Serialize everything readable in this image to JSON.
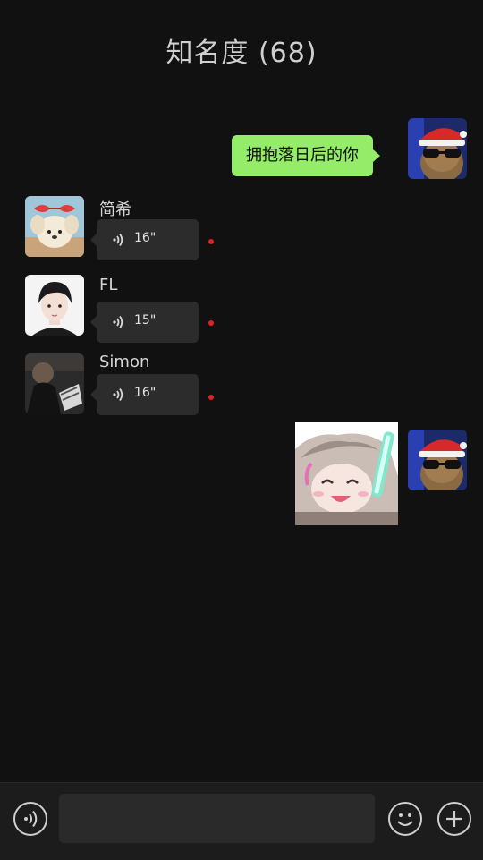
{
  "header": {
    "title": "知名度 (68)"
  },
  "messages": [
    {
      "type": "text",
      "side": "right",
      "text": "拥抱落日后的你",
      "avatar_icon": "santa-hat-cat-sunglasses-avatar"
    },
    {
      "type": "voice",
      "side": "left",
      "sender": "简希",
      "duration": "16\"",
      "unread": true,
      "avatar_icon": "plush-dog-avatar"
    },
    {
      "type": "voice",
      "side": "left",
      "sender": "FL",
      "duration": "15\"",
      "unread": true,
      "avatar_icon": "anime-boy-avatar"
    },
    {
      "type": "voice",
      "side": "left",
      "sender": "Simon",
      "duration": "16\"",
      "unread": true,
      "avatar_icon": "dark-photo-avatar"
    },
    {
      "type": "sticker",
      "side": "right",
      "sticker_icon": "anime-girl-glowstick-sticker",
      "avatar_icon": "santa-hat-cat-sunglasses-avatar"
    }
  ],
  "composer": {
    "voice_toggle_icon": "voice-input-icon",
    "input_value": "",
    "emoji_icon": "emoji-icon",
    "more_icon": "plus-icon"
  },
  "colors": {
    "background": "#111111",
    "outgoing_bubble": "#95ec69",
    "incoming_bubble": "#2c2c2c",
    "unread_dot": "#e1201f"
  }
}
